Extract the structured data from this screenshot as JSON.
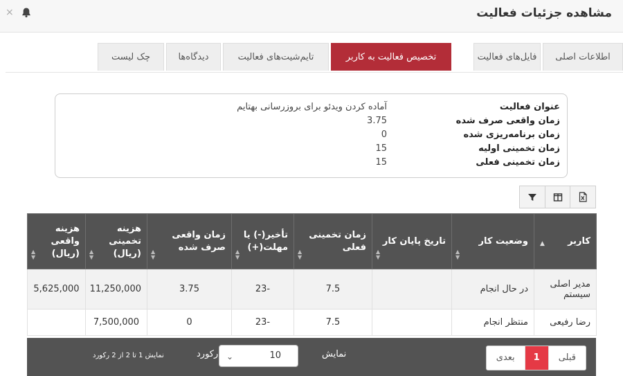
{
  "header": {
    "title": "مشاهده جزئیات فعالیت",
    "close_glyph": "×",
    "bell_icon": "bell-icon"
  },
  "tabs": [
    {
      "label": "اطلاعات اصلی",
      "active": false
    },
    {
      "label": "فایل‌های فعالیت",
      "active": false
    },
    {
      "label": "تخصیص فعالیت به کاربر",
      "active": true
    },
    {
      "label": "تایم‌شیت‌های فعالیت",
      "active": false
    },
    {
      "label": "دیدگاه‌ها",
      "active": false
    },
    {
      "label": "چک لیست",
      "active": false
    }
  ],
  "info": {
    "rows": [
      {
        "label": "عنوان فعالیت",
        "value": "آماده کردن ویدئو برای بروزرسانی بهتایم"
      },
      {
        "label": "زمان واقعی صرف شده",
        "value": "3.75"
      },
      {
        "label": "زمان برنامه‌ریزی شده",
        "value": "0"
      },
      {
        "label": "زمان تخمینی اولیه",
        "value": "15"
      },
      {
        "label": "زمان تخمینی فعلی",
        "value": "15"
      }
    ]
  },
  "toolbar": {
    "icons": [
      "excel-export-icon",
      "columns-icon",
      "filter-icon"
    ]
  },
  "table": {
    "columns": [
      {
        "label": "کاربر"
      },
      {
        "label": "وضعیت کار"
      },
      {
        "label": "تاریخ پایان کار"
      },
      {
        "label": "زمان تخمینی فعلی"
      },
      {
        "label": "تأخیر(-) یا مهلت(+)"
      },
      {
        "label": "زمان واقعی صرف شده"
      },
      {
        "label": "هزینه تخمینی (ریال)"
      },
      {
        "label": "هزینه واقعی (ریال)"
      }
    ],
    "rows": [
      [
        "مدیر اصلی سیستم",
        "در حال انجام",
        "",
        "7.5",
        "-23",
        "3.75",
        "11,250,000",
        "5,625,000"
      ],
      [
        "رضا رفیعی",
        "منتظر انجام",
        "",
        "7.5",
        "-23",
        "0",
        "7,500,000",
        ""
      ]
    ]
  },
  "footer": {
    "pager": {
      "prev": "قبلی",
      "current": "1",
      "next": "بعدی"
    },
    "show_label": "نمایش",
    "page_size": "10",
    "records_label": "رکورد",
    "count_text": "نمایش 1 تا 2 از 2 رکورد"
  }
}
